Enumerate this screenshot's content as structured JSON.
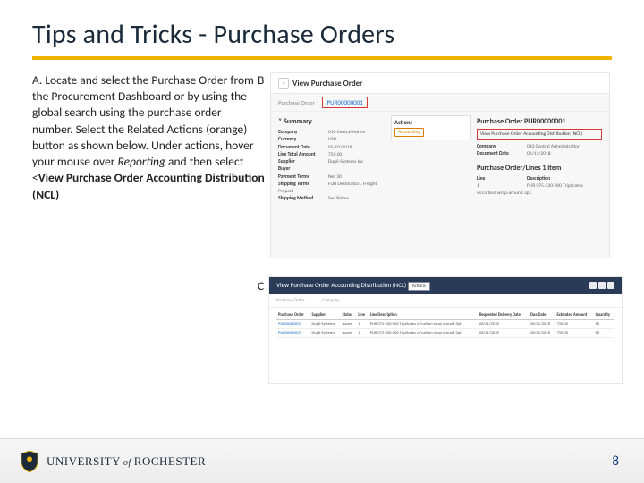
{
  "title": "Tips and Tricks  - Purchase Orders",
  "steps": {
    "a_prefix": "A. Locate and select the Purchase Order from the Procurement Dashboard or by using the global search using the purchase order number. Select the Related Actions (orange) button as shown below. Under actions, hover your mouse over ",
    "a_italic": "Reporting",
    "a_mid": " and then select <",
    "a_bold": "View Purchase Order Accounting Distribution (NCL)",
    "b_letter": "B",
    "c_letter": "C"
  },
  "shotB": {
    "header": "View Purchase Order",
    "po_label": "Purchase Order",
    "po_value": "PUR00000001",
    "summary": "Summary",
    "company_l": "Company",
    "company_v": "010 Central Admin",
    "currency_l": "Currency",
    "currency_v": "USD",
    "docdate_l": "Document Date",
    "docdate_v": "05/01/2018",
    "linetotal_l": "Line Total Amount",
    "linetotal_v": "750.00",
    "supplier_l": "Supplier",
    "supplier_v": "Dupli-Systems Inc",
    "buyer_l": "Buyer",
    "payterms_l": "Payment Terms",
    "payterms_v": "Net 30",
    "shipterms_l": "Shipping Terms",
    "shipterms_v": "FOB Destination, Freight Prepaid",
    "shipmethod_l": "Shipping Method",
    "shipmethod_v": "See Below",
    "actions_title": "Actions",
    "accounting": "Accounting",
    "po_head": "Purchase Order PUR00000001",
    "view_dist": "View Purchase Order Accounting Distribution (NCL)",
    "company2_l": "Company",
    "company2_v": "010 Central Administration",
    "docdate2_l": "Document Date",
    "docdate2_v": "06/11/2018",
    "poline_head": "Purchase Order/Lines 1 item",
    "line_l": "Line",
    "desc_l": "Description",
    "line_v": "1",
    "desc_v": "PUR 075-330-000 Triplicates w/carbon wrap-around 3pt."
  },
  "shotC": {
    "title": "View Purchase Order Accounting Distribution (NCL)",
    "actions": "Actions",
    "filter1": "Purchase Order",
    "filter2": "Company",
    "h1": "Purchase Order",
    "h2": "Supplier",
    "h3": "Status",
    "h4": "Line",
    "h5": "Line Description",
    "h6": "Requested Delivery Date",
    "h7": "Due Date",
    "h8": "Extended Amount",
    "h9": "Quantity",
    "r1c1": "PUR00000001",
    "r1c2": "Dupli-Systems",
    "r1c3": "Issued",
    "r1c4": "1",
    "r1c5": "PUR 075-330-000 Triplicates w/carbon wrap-around 3pt.",
    "r1c6": "06/21/2018",
    "r1c7": "06/21/2018",
    "r1c8": "750.00",
    "r1c9": "60",
    "r2c1": "PUR00000001",
    "r2c2": "Dupli-Systems",
    "r2c3": "Issued",
    "r2c4": "1",
    "r2c5": "PUR 075-330-000 Triplicates w/carbon wrap-around 3pt.",
    "r2c6": "06/21/2018",
    "r2c7": "06/21/2018",
    "r2c8": "750.00",
    "r2c9": "60"
  },
  "footer": {
    "university_pre": "UNIVERSITY",
    "of": "of",
    "university_post": "ROCHESTER",
    "page": "8"
  }
}
